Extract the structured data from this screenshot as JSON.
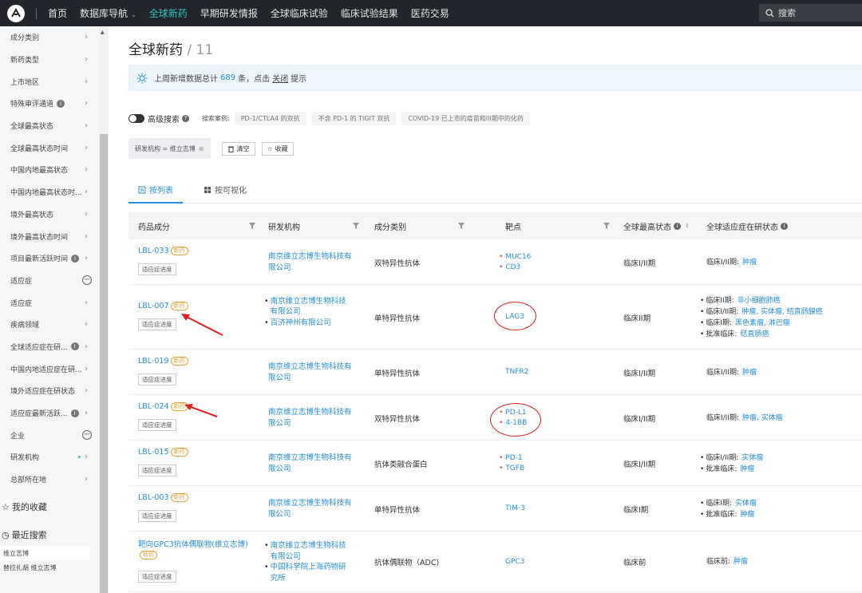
{
  "topnav": {
    "items": [
      "首页",
      "数据库导航",
      "全球新药",
      "早期研发情报",
      "全球临床试验",
      "临床试验结果",
      "医药交易"
    ],
    "active_index": 2,
    "search_label": "搜索"
  },
  "sidebar": {
    "filters": [
      {
        "label": "成分类别"
      },
      {
        "label": "新药类型"
      },
      {
        "label": "上市地区"
      },
      {
        "label": "特殊审评通道",
        "info": true
      },
      {
        "label": "全球最高状态"
      },
      {
        "label": "全球最高状态时间"
      },
      {
        "label": "中国内地最高状态"
      },
      {
        "label": "中国内地最高状态时..."
      },
      {
        "label": "境外最高状态"
      },
      {
        "label": "境外最高状态时间"
      },
      {
        "label": "项目最新活跃时间",
        "info": true
      }
    ],
    "section_indication": "适应症",
    "indication_items": [
      {
        "label": "适应症"
      },
      {
        "label": "疾病领域"
      },
      {
        "label": "全球适应症在研...",
        "info": true
      },
      {
        "label": "中国内地适应症在研..."
      },
      {
        "label": "境外适应症在研状态"
      },
      {
        "label": "适应症最新活跃...",
        "info": true
      }
    ],
    "section_company": "企业",
    "company_items": [
      {
        "label": "研发机构",
        "dot": true
      },
      {
        "label": "总部所在地"
      }
    ],
    "favorites": "我的收藏",
    "recent_search": "最近搜索",
    "recent_items": [
      "维立志博",
      "替拉扎胡 维立志博"
    ]
  },
  "page": {
    "title": "全球新药",
    "count": "11",
    "notice_prefix": "上周新增数据总计",
    "notice_number": "689",
    "notice_mid": "条，点击",
    "notice_link": "关闭",
    "notice_suffix": "提示",
    "advanced_search": "高级搜索",
    "examples_label": "搜索案例:",
    "examples": [
      "PD-1/CTLA4 的双抗",
      "不含 PD-1 的 TIGIT 双抗",
      "COVID-19 已上市的疫苗和III期中的化药"
    ],
    "filter_tag": "研发机构 = 维立志博",
    "clear_button": "清空",
    "save_button": "收藏",
    "tabs": [
      "按列表",
      "按可视化"
    ]
  },
  "table": {
    "columns": [
      "药品成分",
      "研发机构",
      "成分类别",
      "靶点",
      "全球最高状态",
      "全球适应症在研状态"
    ],
    "new_badge": "新药",
    "progress_button": "适应症进度",
    "rows": [
      {
        "drug": "LBL-033",
        "orgs": [
          "南京维立志博生物科技有限公司"
        ],
        "category": "双特异性抗体",
        "targets": [
          "MUC16",
          "CD3"
        ],
        "status": "临床I/II期",
        "indications": [
          {
            "phase": "临床I/II期:",
            "diseases": "肿瘤"
          }
        ]
      },
      {
        "drug": "LBL-007",
        "orgs": [
          "南京维立志博生物科技有限公司",
          "百济神州有限公司"
        ],
        "category": "单特异性抗体",
        "targets": [
          "LAG3"
        ],
        "status": "临床II期",
        "indications": [
          {
            "phase": "临床II期:",
            "diseases": "非小细胞肺癌"
          },
          {
            "phase": "临床I/II期:",
            "diseases": "肿瘤, 实体瘤, 结直肠腺癌"
          },
          {
            "phase": "临床I期:",
            "diseases": "黑色素瘤, 淋巴瘤"
          },
          {
            "phase": "批准临床:",
            "diseases": "结直肠癌"
          }
        ]
      },
      {
        "drug": "LBL-019",
        "orgs": [
          "南京维立志博生物科技有限公司"
        ],
        "category": "单特异性抗体",
        "targets": [
          "TNFR2"
        ],
        "status": "临床I/II期",
        "indications": [
          {
            "phase": "临床I/II期:",
            "diseases": "肿瘤"
          }
        ]
      },
      {
        "drug": "LBL-024",
        "orgs": [
          "南京维立志博生物科技有限公司"
        ],
        "category": "双特异性抗体",
        "targets": [
          "PD-L1",
          "4-1BB"
        ],
        "status": "临床I/II期",
        "indications": [
          {
            "phase": "临床I/II期:",
            "diseases": "肿瘤, 实体瘤"
          }
        ]
      },
      {
        "drug": "LBL-015",
        "orgs": [
          "南京维立志博生物科技有限公司"
        ],
        "category": "抗体类融合蛋白",
        "targets": [
          "PD-1",
          "TGFB"
        ],
        "status": "临床I/II期",
        "indications": [
          {
            "phase": "临床I/II期:",
            "diseases": "实体瘤"
          },
          {
            "phase": "批准临床:",
            "diseases": "肿瘤"
          }
        ]
      },
      {
        "drug": "LBL-003",
        "orgs": [
          "南京维立志博生物科技有限公司"
        ],
        "category": "单特异性抗体",
        "targets": [
          "TIM-3"
        ],
        "status": "临床I期",
        "indications": [
          {
            "phase": "临床I期:",
            "diseases": "实体瘤"
          },
          {
            "phase": "批准临床:",
            "diseases": "肿瘤"
          }
        ]
      },
      {
        "drug": "靶向GPC3抗体偶联物(维立志博)",
        "orgs": [
          "南京维立志博生物科技有限公司",
          "中国科学院上海药物研究所"
        ],
        "category": "抗体偶联物（ADC)",
        "targets": [
          "GPC3"
        ],
        "status": "临床前",
        "indications": [
          {
            "phase": "临床前:",
            "diseases": "肿瘤"
          }
        ]
      }
    ]
  },
  "colors": {
    "topbar_bg": "#22252b",
    "accent_teal": "#27c4c4",
    "link_blue": "#2a8fd6",
    "annotation_red": "#e02020",
    "new_badge": "#e6a23c"
  }
}
